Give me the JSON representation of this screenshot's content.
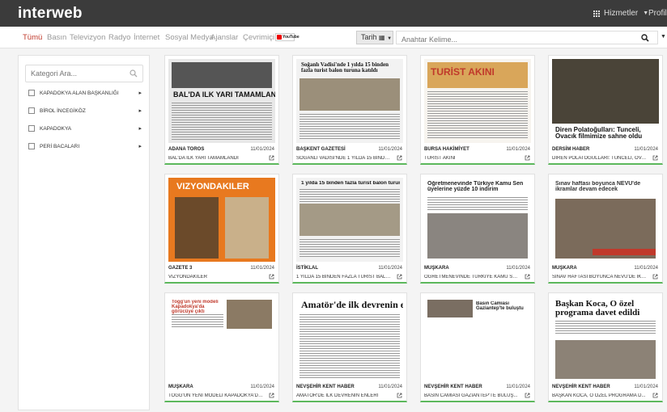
{
  "app": {
    "brand": "interweb"
  },
  "top_menu": {
    "services": "Hizmetler",
    "profile": "Profil"
  },
  "filter_tabs": [
    "Tümü",
    "Basın",
    "Televizyon",
    "Radyo",
    "İnternet",
    "Sosyal Medya",
    "Ajanslar",
    "Çevrimiçi"
  ],
  "youtube_badge": "YouTube",
  "date_button": "Tarih",
  "search": {
    "placeholder": "Anahtar Kelime..."
  },
  "sidebar": {
    "search_placeholder": "Kategori Ara...",
    "categories": [
      "KAPADOKYA ALAN BAŞKANLIĞI",
      "BİROL İNCEGİKÖZ",
      "KAPADOKYA",
      "PERİ BACALARI"
    ]
  },
  "colors": {
    "topbar": "#3b3b3b",
    "active_tab": "#c0392b",
    "card_accent": "#5cb85c"
  },
  "cards": [
    {
      "source": "ADANA TOROS",
      "date": "11/01/2024",
      "title": "BAL'DA İLK YARI TAMAMLANDI",
      "headline": "BAL'DA İLK YARI TAMAMLANDI"
    },
    {
      "source": "BAŞKENT GAZETESİ",
      "date": "11/01/2024",
      "title": "SOĞANLI VADİSİ'NDE 1 YILDA 15 BİNDEN ...",
      "headline": "Soğanlı Vadisi'nde 1 yılda 15 binden fazla turist balon turuna katıldı"
    },
    {
      "source": "BURSA HAKİMİYET",
      "date": "11/01/2024",
      "title": "TURİST AKINI",
      "headline": "TURİST AKINI"
    },
    {
      "source": "DERSİM HABER",
      "date": "11/01/2024",
      "title": "DİREN POLATOĞULLARI: TUNCELİ, OVA...",
      "headline": "Diren Polatoğulları: Tunceli, Ovacık filmimize sahne oldu"
    },
    {
      "source": "GAZETE 3",
      "date": "11/01/2024",
      "title": "VİZYONDAKİLER",
      "headline": "VİZYONDAKİLER"
    },
    {
      "source": "İSTİKLAL",
      "date": "11/01/2024",
      "title": "1 YILDA 15 BİNDEN FAZLA TURİST BALO...",
      "headline": "1 yılda 15 binden fazla turist balon turuna katıldı"
    },
    {
      "source": "MUŞKARA",
      "date": "11/01/2024",
      "title": "ÖĞRETMENEVİNDE TÜRKİYE KAMU SEN...",
      "headline": "Öğretmenevinde Türkiye Kamu Sen üyelerine yüzde 10 indirim"
    },
    {
      "source": "MUŞKARA",
      "date": "11/01/2024",
      "title": "SINAV HAFTASI BOYUNCA NEVÜ'DE İKR...",
      "headline": "Sınav haftası boyunca NEVÜ'de ikramlar devam edecek"
    },
    {
      "source": "MUŞKARA",
      "date": "11/01/2024",
      "title": "TOGG'UN YENİ MODELİ KAPADOKYA'DA...",
      "headline": "Togg'un yeni modeli Kapadokya'da görücüye çıktı"
    },
    {
      "source": "NEVŞEHİR KENT HABER",
      "date": "11/01/2024",
      "title": "AMATÖR'DE İLK DEVRENİN ENLERİ",
      "headline": "Amatör'de ilk devrenin enleri"
    },
    {
      "source": "NEVŞEHİR KENT HABER",
      "date": "11/01/2024",
      "title": "BASIN CAMİASI GAZİANTEP'TE BULUŞ...",
      "headline": "Basın Camiası Gaziantep'te buluştu"
    },
    {
      "source": "NEVŞEHİR KENT HABER",
      "date": "11/01/2024",
      "title": "BAŞKAN KOCA, O ÖZEL PROGRAMA D...",
      "headline": "Başkan Koca, O özel programa davet edildi"
    }
  ]
}
